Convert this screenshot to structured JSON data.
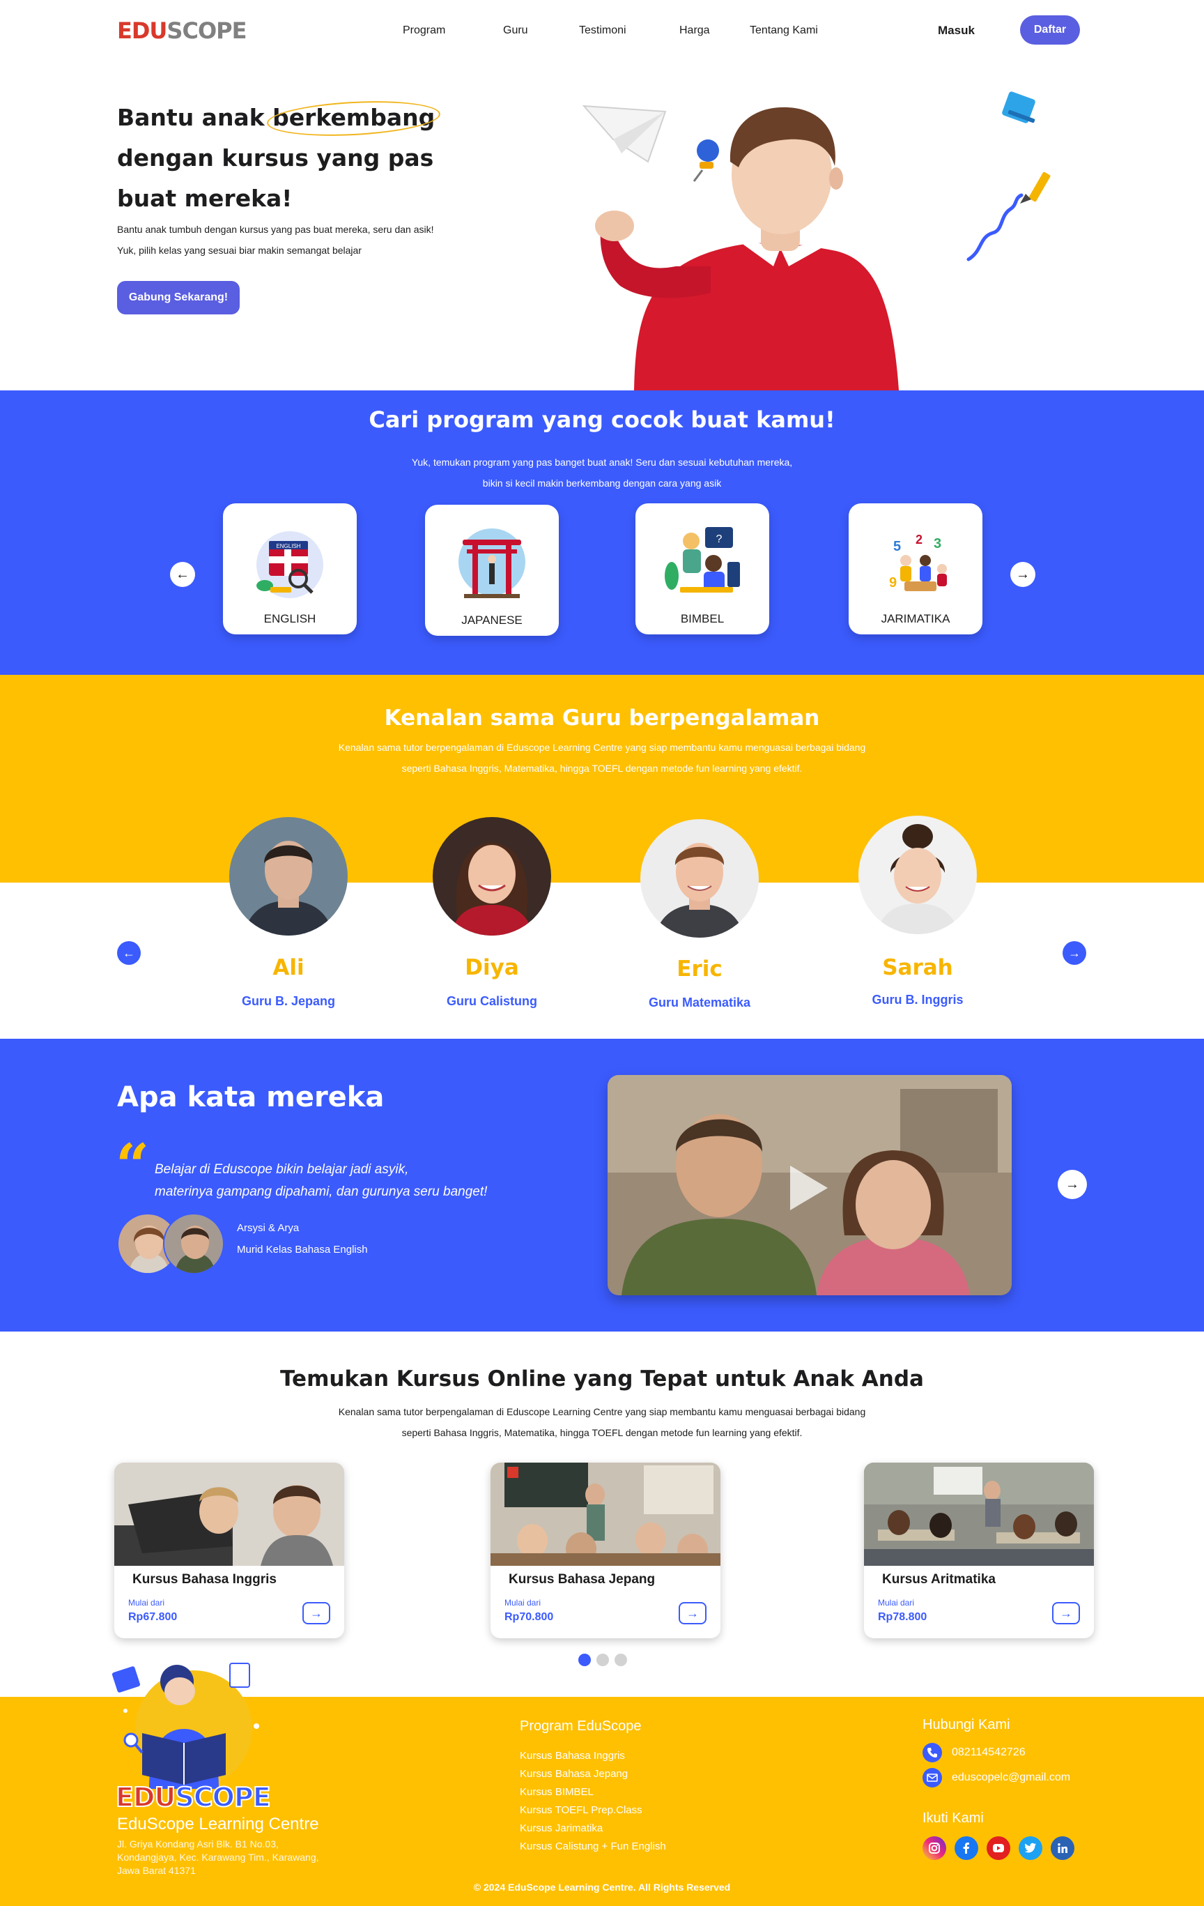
{
  "brand": {
    "edu": "EDU",
    "scope": "SCOPE"
  },
  "nav": {
    "items": [
      "Program",
      "Guru",
      "Testimoni",
      "Harga",
      "Tentang Kami"
    ],
    "login": "Masuk",
    "register": "Daftar"
  },
  "hero": {
    "title_pre": "Bantu anak ",
    "title_highlight": "berkembang",
    "title_line2": "dengan kursus yang pas",
    "title_line3": "buat mereka!",
    "sub1": "Bantu anak tumbuh dengan kursus yang pas buat mereka, seru dan asik!",
    "sub2": "Yuk, pilih kelas yang sesuai biar makin semangat belajar",
    "cta": "Gabung Sekarang!"
  },
  "programs": {
    "title": "Cari program yang cocok buat kamu!",
    "desc1": "Yuk, temukan program yang pas banget buat anak! Seru dan sesuai kebutuhan mereka,",
    "desc2": "bikin si kecil makin berkembang dengan cara yang asik",
    "items": [
      {
        "label": "ENGLISH",
        "badge": "ENGLISH"
      },
      {
        "label": "JAPANESE"
      },
      {
        "label": "BIMBEL"
      },
      {
        "label": "JARIMATIKA"
      }
    ],
    "colors": {
      "section_bg": "#3b5bfd"
    }
  },
  "teachers": {
    "title": "Kenalan sama Guru berpengalaman",
    "desc1": "Kenalan sama tutor berpengalaman di Eduscope Learning Centre yang siap membantu kamu menguasai berbagai bidang",
    "desc2": "seperti Bahasa Inggris, Matematika, hingga TOEFL dengan metode fun learning yang efektif.",
    "items": [
      {
        "name": "Ali",
        "role": "Guru B. Jepang"
      },
      {
        "name": "Diya",
        "role": "Guru Calistung"
      },
      {
        "name": "Eric",
        "role": "Guru Matematika"
      },
      {
        "name": "Sarah",
        "role": "Guru B. Inggris"
      }
    ],
    "colors": {
      "section_bg": "#ffc002",
      "name": "#f7b500"
    }
  },
  "testimonial": {
    "title": "Apa kata mereka",
    "quote_mark": "“",
    "line1": "Belajar di Eduscope bikin belajar jadi asyik,",
    "line2": "materinya gampang dipahami, dan gurunya seru banget!",
    "person_name": "Arsysi & Arya",
    "person_role": "Murid Kelas Bahasa English"
  },
  "courses": {
    "title": "Temukan Kursus Online yang Tepat untuk Anak Anda",
    "desc1": "Kenalan sama tutor berpengalaman di Eduscope Learning Centre yang siap membantu kamu menguasai berbagai bidang",
    "desc2": "seperti Bahasa Inggris, Matematika, hingga TOEFL dengan metode fun learning yang efektif.",
    "from_label": "Mulai dari",
    "items": [
      {
        "name": "Kursus Bahasa Inggris",
        "price": "Rp67.800"
      },
      {
        "name": "Kursus Bahasa Jepang",
        "price": "Rp70.800"
      },
      {
        "name": "Kursus Aritmatika",
        "price": "Rp78.800"
      }
    ],
    "pagination": {
      "current": 1,
      "total": 3
    }
  },
  "footer": {
    "brand_edu": "EDU",
    "brand_scope": "SCOPE",
    "org_name": "EduScope Learning Centre",
    "address": "Jl. Griya Kondang Asri Blk. B1 No.03, Kondangjaya, Kec. Karawang Tim., Karawang, Jawa Barat 41371",
    "programs_head": "Program EduScope",
    "programs": [
      "Kursus Bahasa Inggris",
      "Kursus Bahasa Jepang",
      "Kursus BIMBEL",
      "Kursus TOEFL Prep.Class",
      "Kursus Jarimatika",
      "Kursus Calistung + Fun English"
    ],
    "contact_head": "Hubungi Kami",
    "phone": "082114542726",
    "email": "eduscopelc@gmail.com",
    "follow_head": "Ikuti Kami",
    "socials": [
      "instagram-icon",
      "facebook-icon",
      "youtube-icon",
      "twitter-icon",
      "linkedin-icon"
    ],
    "copyright": "© 2024 EduScope Learning Centre. All Rights Reserved"
  }
}
